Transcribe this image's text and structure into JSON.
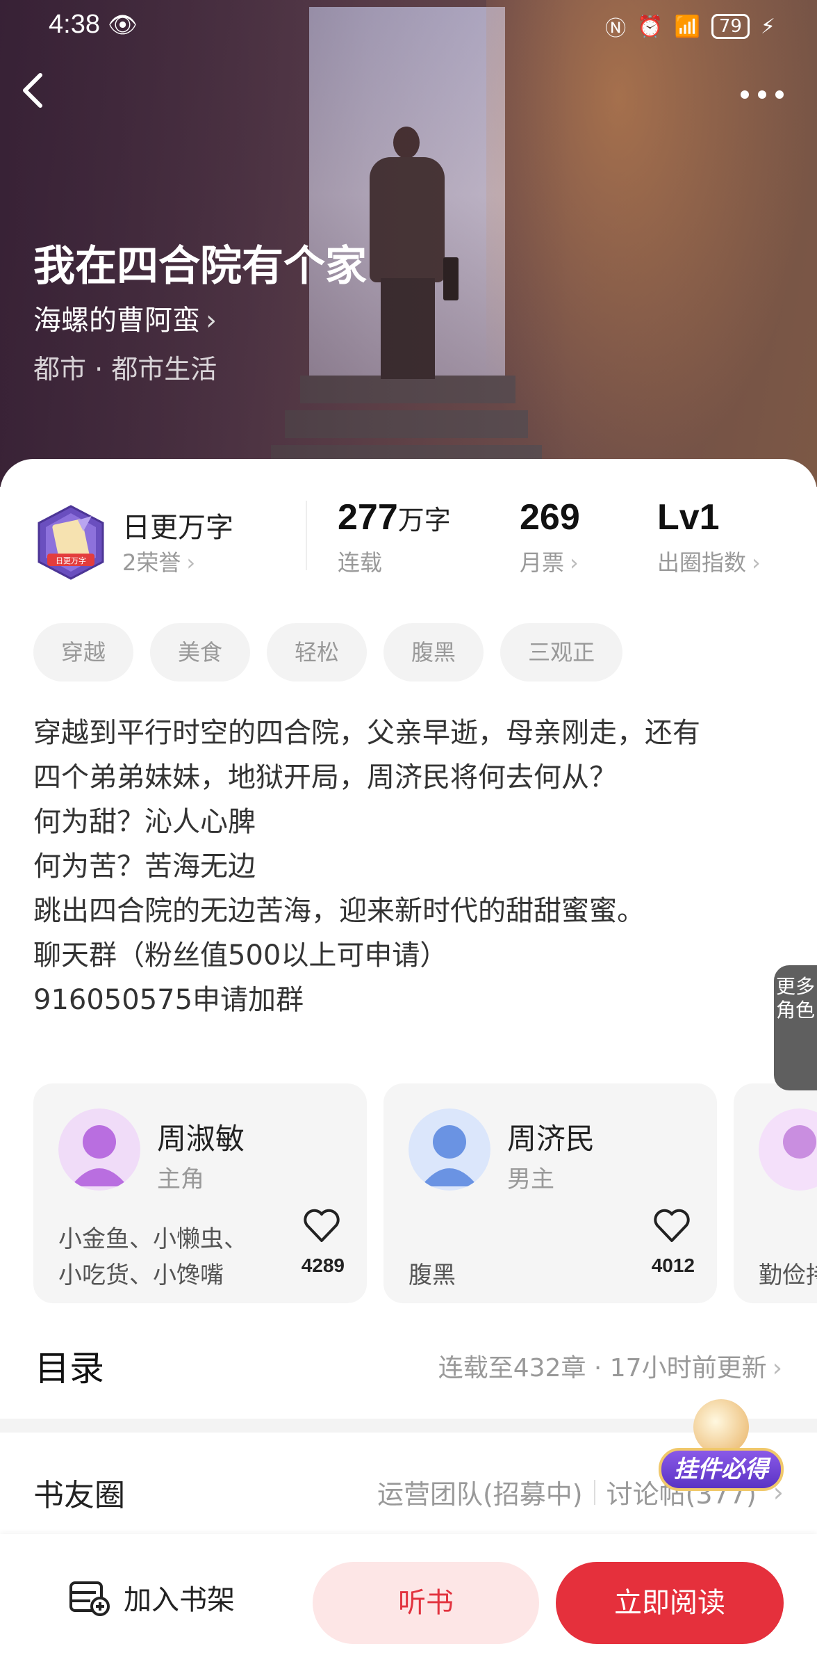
{
  "status_bar": {
    "time": "4:38",
    "battery": "79"
  },
  "book": {
    "title": "我在四合院有个家",
    "author": "海螺的曹阿蛮",
    "genre": "都市 · 都市生活"
  },
  "honor": {
    "title": "日更万字",
    "subtitle": "2荣誉",
    "badge_text": "日更万字"
  },
  "stats": [
    {
      "value": "277",
      "unit": "万字",
      "label": "连载"
    },
    {
      "value": "269",
      "unit": "",
      "label": "月票"
    },
    {
      "value": "Lv1",
      "unit": "",
      "label": "出圈指数"
    }
  ],
  "tags": [
    "穿越",
    "美食",
    "轻松",
    "腹黑",
    "三观正"
  ],
  "description": [
    "穿越到平行时空的四合院，父亲早逝，母亲刚走，还有",
    "四个弟弟妹妹，地狱开局，周济民将何去何从？",
    "何为甜？沁人心脾",
    "何为苦？苦海无边",
    "跳出四合院的无边苦海，迎来新时代的甜甜蜜蜜。",
    "聊天群（粉丝值500以上可申请）",
    "916050575申请加群"
  ],
  "roles": [
    {
      "name": "周淑敏",
      "type": "主角",
      "tags": "小金鱼、小懒虫、小吃货、小馋嘴",
      "likes": "4289",
      "color": "#c58be8"
    },
    {
      "name": "周济民",
      "type": "男主",
      "tags": "腹黑",
      "likes": "4012",
      "color": "#7fa6ea"
    },
    {
      "name": "",
      "type": "",
      "tags": "勤俭持",
      "likes": "",
      "color": "#d3a3e6"
    }
  ],
  "more_roles_label": "更多角色",
  "toc": {
    "title": "目录",
    "info": "连载至432章 · 17小时前更新"
  },
  "circle": {
    "title": "书友圈",
    "team": "运营团队(招募中)",
    "posts": "讨论帖(377)"
  },
  "pendant_label": "挂件必得",
  "bottom": {
    "shelf": "加入书架",
    "listen": "听书",
    "read": "立即阅读"
  },
  "colors": {
    "accent": "#e5303c",
    "listen_bg": "#fde6e6",
    "tag_bg": "#f3f3f3"
  }
}
